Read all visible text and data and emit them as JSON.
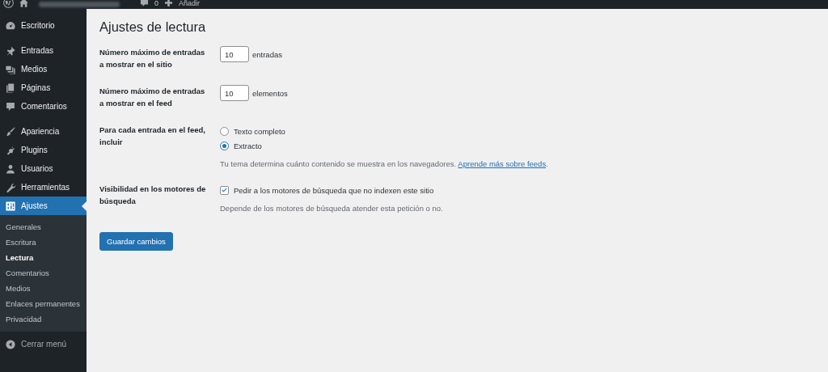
{
  "admin_bar": {
    "comments_count": "0",
    "add_label": "Añadir"
  },
  "sidebar": {
    "items": [
      {
        "label": "Escritorio",
        "selected": false
      },
      {
        "label": "Entradas",
        "selected": false
      },
      {
        "label": "Medios",
        "selected": false
      },
      {
        "label": "Páginas",
        "selected": false
      },
      {
        "label": "Comentarios",
        "selected": false
      },
      {
        "label": "Apariencia",
        "selected": false
      },
      {
        "label": "Plugins",
        "selected": false
      },
      {
        "label": "Usuarios",
        "selected": false
      },
      {
        "label": "Herramientas",
        "selected": false
      },
      {
        "label": "Ajustes",
        "selected": true,
        "children": [
          {
            "label": "Generales",
            "selected": false
          },
          {
            "label": "Escritura",
            "selected": false
          },
          {
            "label": "Lectura",
            "selected": true
          },
          {
            "label": "Comentarios",
            "selected": false
          },
          {
            "label": "Medios",
            "selected": false
          },
          {
            "label": "Enlaces permanentes",
            "selected": false
          },
          {
            "label": "Privacidad",
            "selected": false
          }
        ]
      }
    ],
    "collapse": "Cerrar menú"
  },
  "page": {
    "title": "Ajustes de lectura",
    "settings": [
      {
        "kind": "number",
        "label": "Número máximo de entradas a mostrar en el sitio",
        "value": "10",
        "unit": "entradas"
      },
      {
        "kind": "number",
        "label": "Número máximo de entradas a mostrar en el feed",
        "value": "10",
        "unit": "elementos"
      },
      {
        "kind": "radio",
        "label": "Para cada entrada en el feed, incluir",
        "options": [
          {
            "label": "Texto completo",
            "selected": false
          },
          {
            "label": "Extracto",
            "selected": true
          }
        ],
        "description": "Tu tema determina cuánto contenido se muestra en los navegadores.",
        "link": "Aprende más sobre feeds",
        "link_suffix": "."
      },
      {
        "kind": "checkbox",
        "label": "Visibilidad en los motores de búsqueda",
        "option": "Pedir a los motores de búsqueda que no indexen este sitio",
        "checked": true,
        "description": "Depende de los motores de búsqueda atender esta petición o no."
      }
    ],
    "save_button": "Guardar cambios"
  }
}
